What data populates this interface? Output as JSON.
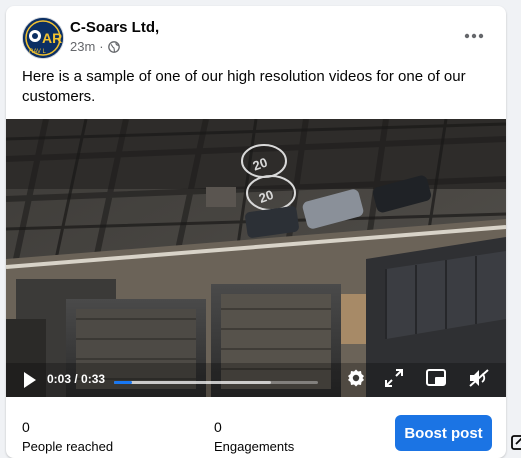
{
  "post": {
    "page_name": "C-Soars Ltd,",
    "time_ago": "23m",
    "separator": "·",
    "audience_icon": "globe-icon",
    "caption": "Here is a sample of one of our high resolution videos for one of our customers."
  },
  "video": {
    "current_time": "0:03",
    "duration": "0:33",
    "time_display": "0:03 / 0:33",
    "progress_fraction": 0.09,
    "buffered_fraction": 0.77,
    "controls": [
      "play-icon",
      "settings-icon",
      "fullscreen-icon",
      "picture-in-picture-icon",
      "mute-icon"
    ]
  },
  "stats": {
    "people_reached_value": "0",
    "people_reached_label": "People reached",
    "engagements_value": "0",
    "engagements_label": "Engagements"
  },
  "actions": {
    "boost_label": "Boost post"
  },
  "colors": {
    "accent": "#1b74e4",
    "secondary_text": "#65676b",
    "progress": "#1877f2"
  }
}
